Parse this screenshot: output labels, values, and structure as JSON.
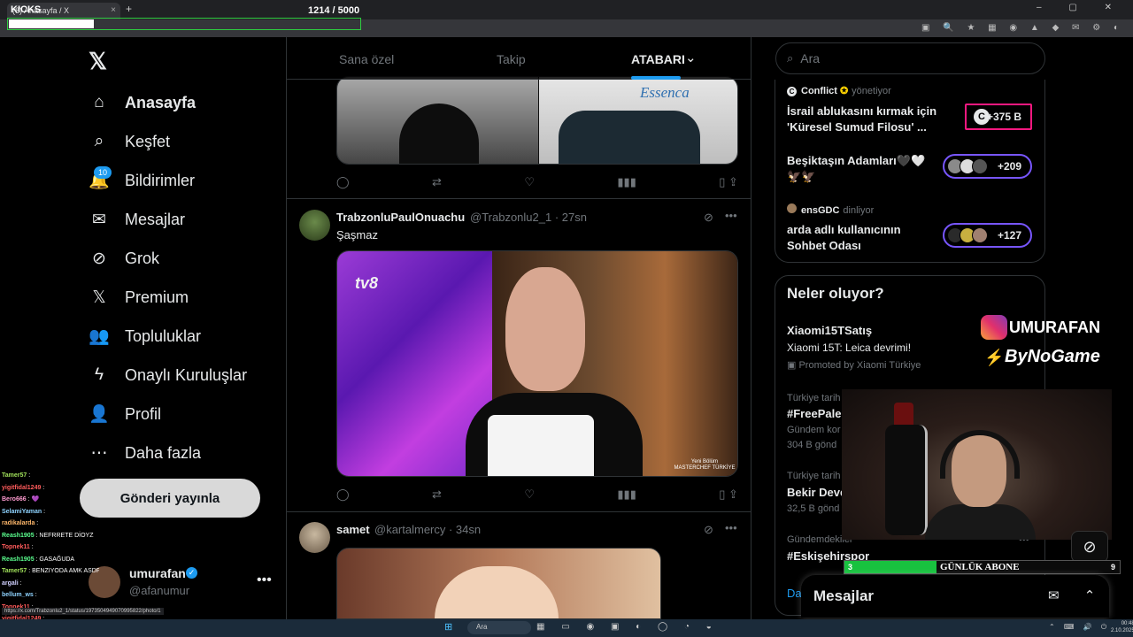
{
  "browser": {
    "tab_title": "(8) Anasayfa / X",
    "tab_close": "×",
    "new_tab": "+",
    "window_controls": "–  ▢  ✕",
    "extensions": "▣ 🔍 ★ ▦ ◉ ▲ ◆ ✉ ⚙ ◐"
  },
  "kicks": {
    "label": "KICKS",
    "count": "1214  / 5000",
    "progress": 0.2428
  },
  "sidebar": {
    "logo": "𝕏",
    "nav": [
      {
        "label": "Anasayfa",
        "icon": "home-icon",
        "glyph": "⌂"
      },
      {
        "label": "Keşfet",
        "icon": "search-icon",
        "glyph": "⌕"
      },
      {
        "label": "Bildirimler",
        "icon": "bell-icon",
        "glyph": "🔔"
      },
      {
        "label": "Mesajlar",
        "icon": "mail-icon",
        "glyph": "✉"
      },
      {
        "label": "Grok",
        "icon": "grok-icon",
        "glyph": "⊘"
      },
      {
        "label": "Premium",
        "icon": "x-premium-icon",
        "glyph": "𝕏"
      },
      {
        "label": "Topluluklar",
        "icon": "communities-icon",
        "glyph": "👥"
      },
      {
        "label": "Onaylı Kuruluşlar",
        "icon": "lightning-icon",
        "glyph": "ϟ"
      },
      {
        "label": "Profil",
        "icon": "person-icon",
        "glyph": "👤"
      },
      {
        "label": "Daha fazla",
        "icon": "more-circle-icon",
        "glyph": "⋯"
      }
    ],
    "notif_count": "10",
    "post_button": "Gönderi yayınla",
    "profile_name": "umurafan",
    "profile_handle": "@afanumur",
    "profile_more": "•••"
  },
  "chat": [
    {
      "user": "Tamer57",
      "msg": ":",
      "color": "#a0e05a"
    },
    {
      "user": "yigitfidal1249",
      "msg": ":",
      "color": "#ff5b5b"
    },
    {
      "user": "Bero666",
      "msg": ": 💜",
      "color": "#ff9bd0"
    },
    {
      "user": "SelamiYaman",
      "msg": ":",
      "color": "#8fd3ff"
    },
    {
      "user": "radikalarda",
      "msg": ":",
      "color": "#ffb86b"
    },
    {
      "user": "Reash1905",
      "msg": ": NEFRRETE DİOYZ",
      "color": "#5bff8f"
    },
    {
      "user": "Topnek11",
      "msg": ":",
      "color": "#ff5b5b"
    },
    {
      "user": "Reash1905",
      "msg": ": GASAĞUDA",
      "color": "#5bff8f"
    },
    {
      "user": "Tamer57",
      "msg": ": BENZIYODA AMK ASDFGSDFSDFSDF",
      "color": "#a0e05a"
    },
    {
      "user": "argali",
      "msg": ":",
      "color": "#d0d0ff"
    },
    {
      "user": "bellum_ws",
      "msg": ":",
      "color": "#8fd3ff"
    },
    {
      "user": "Topnek11",
      "msg": ":",
      "color": "#ff5b5b"
    },
    {
      "user": "yigitfidal1249",
      "msg": ":",
      "color": "#ff5b5b"
    },
    {
      "user": "miy06mily860",
      "msg": ":",
      "color": "#ffd36b"
    }
  ],
  "status_url": "https://x.com/Trabzonlu2_1/status/1973504949070995822/photo/1",
  "timeline": {
    "tabs": [
      "Sana özel",
      "Takip",
      "ATABARI"
    ],
    "dropdown_glyph": "⌄",
    "posts": [
      {
        "name": "TrabzonluPaulOnuachu",
        "handle": "@Trabzonlu2_1 · 27sn",
        "text": "Şaşmaz",
        "media_label_tv": "tv8",
        "media_label_show": "Yeni Bölüm MASTERCHEF TÜRKİYE"
      },
      {
        "name": "samet",
        "handle": "@kartalmercy · 34sn"
      }
    ],
    "prev_media_label": "Essenca"
  },
  "search": {
    "placeholder": "Ara"
  },
  "spaces": [
    {
      "host": "Conflict",
      "role": "yönetiyor",
      "title": "İsrail ablukasını kırmak için 'Küresel Sumud Filosu' ...",
      "count": "+375 B"
    },
    {
      "host": "",
      "role": "",
      "title": "Beşiktaşın Adamları🖤🤍🦅🦅",
      "count": "+209"
    },
    {
      "host": "ensGDC",
      "role": "dinliyor",
      "title": "arda adlı kullanıcının Sohbet Odası",
      "count": "+127"
    }
  ],
  "trends": {
    "title": "Neler oluyor?",
    "promoted": {
      "name": "Xiaomi15TSatış",
      "sub": "Xiaomi 15T: Leica devrimi!",
      "promo": "Promoted by Xiaomi Türkiye"
    },
    "items": [
      {
        "meta": "Türkiye tarih",
        "name": "#FreePale",
        "count1": "Gündem kor",
        "count2": "304 B gönd"
      },
      {
        "meta": "Türkiye tarih",
        "name": "Bekir Deve",
        "count1": "32,5 B gönd",
        "count2": ""
      },
      {
        "meta": "Gündemdekiler",
        "name": "#Eskişehirspor",
        "count1": "",
        "count2": ""
      }
    ],
    "more_partial": "Da",
    "more_glyph": "•••"
  },
  "messages_drawer": {
    "title": "Mesajlar",
    "icons": "✉ ⌃"
  },
  "overlay": {
    "instagram": "UMURAFAN",
    "bynogame": "ByNoGame",
    "bynogame_mark": "⚡",
    "abone_label": "GÜNLÜK ABONE",
    "abone_current": "3",
    "abone_goal": "9",
    "abone_progress": 0.333
  },
  "taskbar": {
    "start_glyph": "⊞",
    "search": "Ara",
    "apps": "▦ ▭ ◉ ▣ ◐ ◯ ◔ ◒",
    "tray": "⌃ ⌨ 🔊 ⏻",
    "time": "00:48",
    "date": "2.10.2025"
  },
  "colors": {
    "accent": "#1d9bf0",
    "background": "#000000",
    "text": "#e7e9ea",
    "muted": "#71767b",
    "spaces_border": "#7856ff",
    "promo_border": "#f91880"
  }
}
